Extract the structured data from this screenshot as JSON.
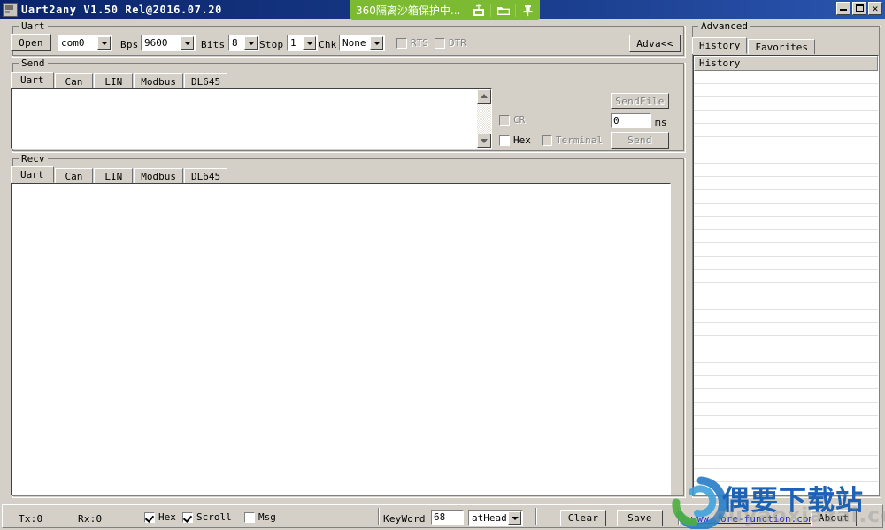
{
  "window": {
    "title": "Uart2any  V1.50  Rel@2016.07.20",
    "icon": "app-icon",
    "minimize_label": "_",
    "maximize_label": "□",
    "close_label": "✕",
    "titlebar_color": "#0a246a"
  },
  "sandbox": {
    "text": "360隔离沙箱保护中...",
    "color": "#7cbb31",
    "icons": [
      "package-icon",
      "folder-icon",
      "pin-icon"
    ]
  },
  "uart": {
    "group_label": "Uart",
    "open_button": "Open",
    "port": {
      "value": "com0",
      "options": [
        "com0"
      ]
    },
    "bps": {
      "label": "Bps",
      "value": "9600",
      "options": [
        "9600"
      ]
    },
    "bits": {
      "label": "Bits",
      "value": "8",
      "options": [
        "8"
      ]
    },
    "stop": {
      "label": "Stop",
      "value": "1",
      "options": [
        "1"
      ]
    },
    "chk": {
      "label": "Chk",
      "value": "None",
      "options": [
        "None"
      ]
    },
    "rts": {
      "label": "RTS",
      "checked": false,
      "enabled": false
    },
    "dtr": {
      "label": "DTR",
      "checked": false,
      "enabled": false
    },
    "advanced_button": "Adva<<"
  },
  "send": {
    "group_label": "Send",
    "tabs": [
      {
        "label": "Uart",
        "active": true
      },
      {
        "label": "Can",
        "active": false
      },
      {
        "label": "LIN",
        "active": false
      },
      {
        "label": "Modbus",
        "active": false
      },
      {
        "label": "DL645",
        "active": false
      }
    ],
    "text": "",
    "cr": {
      "label": "CR",
      "checked": false,
      "enabled": false
    },
    "hex": {
      "label": "Hex",
      "checked": false,
      "enabled": true
    },
    "terminal": {
      "label": "Terminal",
      "checked": false,
      "enabled": false
    },
    "sendfile_button": {
      "label": "SendFile",
      "enabled": false
    },
    "interval": {
      "value": "0",
      "unit": "ms"
    },
    "send_button": {
      "label": "Send",
      "enabled": false
    }
  },
  "recv": {
    "group_label": "Recv",
    "tabs": [
      {
        "label": "Uart",
        "active": true
      },
      {
        "label": "Can",
        "active": false
      },
      {
        "label": "LIN",
        "active": false
      },
      {
        "label": "Modbus",
        "active": false
      },
      {
        "label": "DL645",
        "active": false
      }
    ],
    "text": ""
  },
  "advanced": {
    "group_label": "Advanced",
    "tabs": [
      {
        "label": "History",
        "active": true
      },
      {
        "label": "Favorites",
        "active": false
      }
    ],
    "list": {
      "header": "History",
      "rows": []
    }
  },
  "status": {
    "tx": "Tx:0",
    "rx": "Rx:0",
    "hex": {
      "label": "Hex",
      "checked": true
    },
    "scroll": {
      "label": "Scroll",
      "checked": true
    },
    "msg": {
      "label": "Msg",
      "checked": false
    },
    "keyword": {
      "label": "KeyWord",
      "value": "68"
    },
    "position": {
      "value": "atHead",
      "options": [
        "atHead"
      ]
    },
    "clear_button": "Clear",
    "save_button": "Save",
    "website": "www.more-function.com",
    "about_button": "About"
  },
  "watermark": {
    "title": "偶要下载站",
    "subtitle": "ouyaoxiazai.com"
  }
}
